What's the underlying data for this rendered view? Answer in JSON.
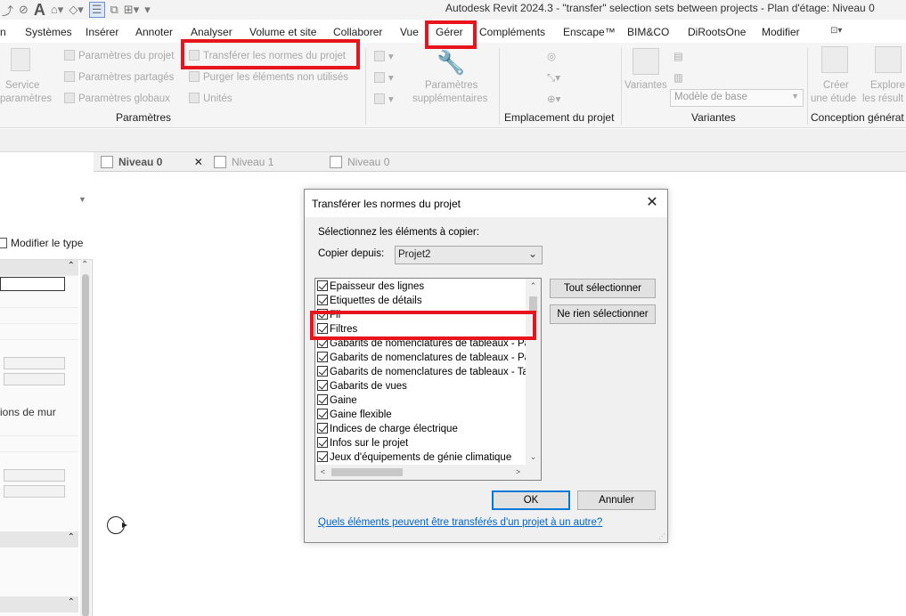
{
  "window": {
    "title": "Autodesk Revit 2024.3 - \"transfer\" selection sets between projects - Plan d'étage: Niveau 0"
  },
  "ribbon_tabs": [
    "Systèmes",
    "Insérer",
    "Annoter",
    "Analyser",
    "Volume et site",
    "Collaborer",
    "Vue",
    "Gérer",
    "Compléments",
    "Enscape™",
    "BIM&CO",
    "DiRootsOne",
    "Modifier"
  ],
  "active_tab": "Gérer",
  "ribbon": {
    "service_label_1": "Service",
    "service_label_2": "paramètres",
    "params_projet": "Paramètres du projet",
    "params_partages": "Paramètres partagés",
    "params_globaux": "Paramètres globaux",
    "transferer": "Transférer les normes du projet",
    "purger": "Purger les éléments non utilisés",
    "unites": "Unités",
    "params_supp_1": "Paramètres",
    "params_supp_2": "supplémentaires",
    "variantes": "Variantes",
    "modele_de_base": "Modèle de base",
    "creer_1": "Créer",
    "creer_2": "une étude",
    "explorer_1": "Explore",
    "explorer_2": "les résult",
    "panel_parametres": "Paramètres",
    "panel_emplacement": "Emplacement du projet",
    "panel_variantes": "Variantes",
    "panel_conception": "Conception générat"
  },
  "properties": {
    "modify_type": "Modifier le type",
    "wall_label": "ions de mur"
  },
  "view_tabs": [
    "Niveau 0",
    "Niveau 1",
    "Niveau 0"
  ],
  "dialog": {
    "title": "Transférer les normes du projet",
    "prompt": "Sélectionnez les éléments à copier:",
    "copy_from_label": "Copier depuis:",
    "copy_from_value": "Projet2",
    "items": [
      "Epaisseur des lignes",
      "Etiquettes de détails",
      "Fil",
      "Filtres",
      "Gabarits de nomenclatures de tableaux - Pann",
      "Gabarits de nomenclatures de tableaux - Pann",
      "Gabarits de nomenclatures de tableaux - Tabl",
      "Gabarits de vues",
      "Gaine",
      "Gaine flexible",
      "Indices de charge électrique",
      "Infos sur le projet",
      "Jeux d'équipements de génie climatique"
    ],
    "select_all": "Tout sélectionner",
    "select_none": "Ne rien sélectionner",
    "ok": "OK",
    "cancel": "Annuler",
    "help_link": "Quels éléments peuvent être transférés d'un projet à un autre?"
  },
  "highlight_color": "#e8141d"
}
